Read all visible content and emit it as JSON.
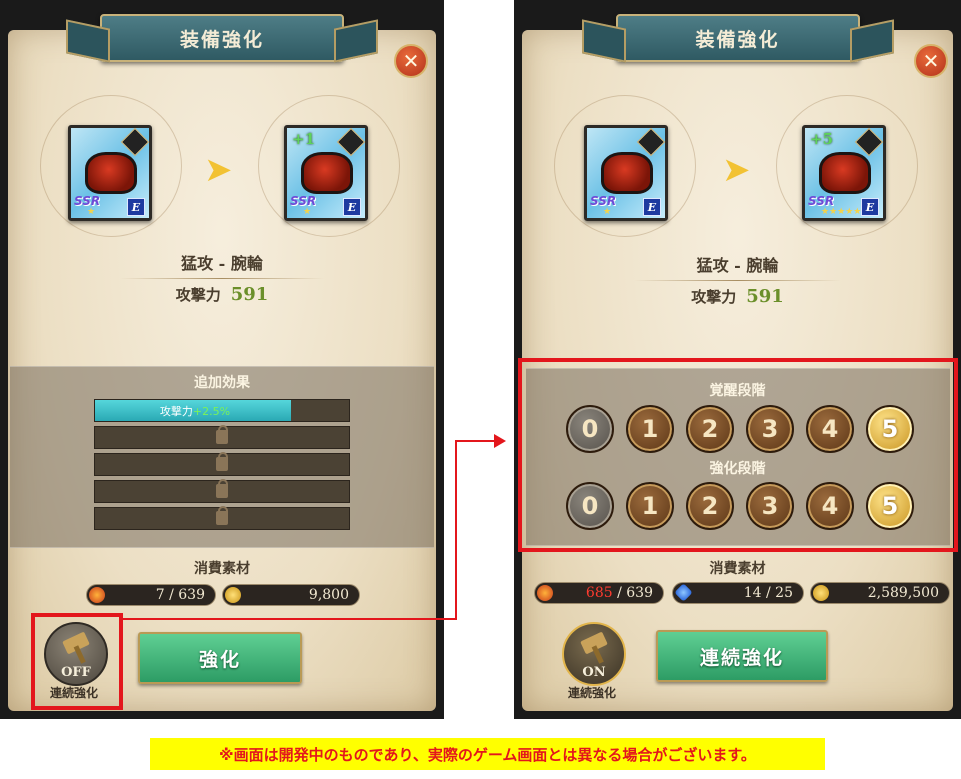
{
  "left_screen": {
    "title": "装備強化",
    "item_name": "猛攻 - 腕輪",
    "stat_label": "攻撃力",
    "stat_value": "591",
    "before_card": {
      "ssr": "SSR",
      "rank": "E",
      "stars": "★"
    },
    "after_card": {
      "plus": "+1",
      "ssr": "SSR",
      "rank": "E",
      "stars": "★"
    },
    "extra_effects_title": "追加効果",
    "effects": [
      {
        "label": "攻撃力",
        "bonus": "+2.5%",
        "locked": false,
        "fill_fraction": 0.77
      },
      {
        "locked": true
      },
      {
        "locked": true
      },
      {
        "locked": true
      },
      {
        "locked": true
      }
    ],
    "cost_title": "消費素材",
    "cost_material": "7 / 639",
    "cost_gold": "9,800",
    "toggle_state": "OFF",
    "toggle_label": "連続強化",
    "action_button": "強化"
  },
  "right_screen": {
    "title": "装備強化",
    "item_name": "猛攻 - 腕輪",
    "stat_label": "攻撃力",
    "stat_value": "591",
    "before_card": {
      "ssr": "SSR",
      "rank": "E",
      "stars": "★"
    },
    "after_card": {
      "plus": "+5",
      "ssr": "SSR",
      "rank": "E",
      "stars": "★★★★★"
    },
    "awakening_title": "覚醒段階",
    "awakening_stages": [
      "0",
      "1",
      "2",
      "3",
      "4",
      "5"
    ],
    "awakening_selected": "5",
    "enhance_title": "強化段階",
    "enhance_stages": [
      "0",
      "1",
      "2",
      "3",
      "4",
      "5"
    ],
    "enhance_selected": "5",
    "cost_title": "消費素材",
    "cost_material_have": "685",
    "cost_material_need": "/ 639",
    "cost_gem": "14 / 25",
    "cost_gold": "2,589,500",
    "toggle_state": "ON",
    "toggle_label": "連続強化",
    "action_button": "連続強化"
  },
  "disclaimer": "※画面は開発中のものであり、実際のゲーム画面とは異なる場合がございます。",
  "colors": {
    "highlight_red": "#e3161c",
    "disclaimer_bg": "#ffff00",
    "stat_green": "#6b8f2a",
    "button_green": "#2d9c65"
  }
}
